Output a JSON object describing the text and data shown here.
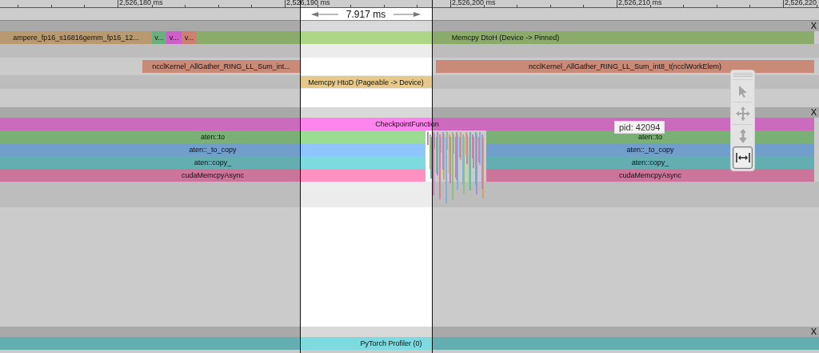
{
  "ruler": {
    "ticks": [
      "2,526,180 ms",
      "2,526,190 ms",
      "2,526,200 ms",
      "2,526,210 ms",
      "2,526,220"
    ]
  },
  "selection": {
    "duration": "7.917 ms"
  },
  "processes": [
    {
      "close": "X",
      "tracks": [
        {
          "slices": [
            {
              "label": "ampere_fp16_s16816gemm_fp16_12...",
              "color": "#b99a70"
            },
            {
              "label": "v...",
              "color": "#6ab07e"
            },
            {
              "label": "v...",
              "color": "#cc60c8"
            },
            {
              "label": "v...",
              "color": "#cc8070"
            },
            {
              "label": "Memcpy DtoH (Device -> Pinned)",
              "color": "#8aab6a"
            }
          ]
        },
        {
          "slices": [
            {
              "label": "ncclKernel_AllGather_RING_LL_Sum_int...",
              "color": "#c98a78"
            },
            {
              "label": "ncclKernel_AllGather_RING_LL_Sum_int8_t(ncclWorkElem)",
              "color": "#c98a78"
            }
          ]
        },
        {
          "slices": [
            {
              "label": "Memcpy HtoD (Pageable -> Device)",
              "color": "#e6c98a"
            }
          ]
        }
      ]
    },
    {
      "close": "X",
      "tracks": [
        {
          "slices": [
            {
              "label": "CheckpointFunction",
              "color": "#cc6abe"
            }
          ]
        },
        {
          "slices": [
            {
              "label": "aten::to",
              "color": "#7ab075"
            },
            {
              "label": "aten::to",
              "color": "#7ab075"
            }
          ]
        },
        {
          "slices": [
            {
              "label": "aten::_to_copy",
              "color": "#729ecc"
            },
            {
              "label": "aten::_to_copy",
              "color": "#729ecc"
            }
          ]
        },
        {
          "slices": [
            {
              "label": "aten::copy_",
              "color": "#64aeb2"
            },
            {
              "label": "aten::copy_",
              "color": "#64aeb2"
            }
          ]
        },
        {
          "slices": [
            {
              "label": "cudaMemcpyAsync",
              "color": "#cc749a"
            },
            {
              "label": "cudaMemcpyAsync",
              "color": "#cc749a"
            }
          ]
        }
      ]
    },
    {
      "close": "X",
      "tracks": [
        {
          "slices": [
            {
              "label": "PyTorch Profiler (0)",
              "color": "#64aeb2"
            }
          ]
        }
      ]
    }
  ],
  "tooltip": "pid: 42094",
  "toolbar": {
    "tools": [
      {
        "kind": "select",
        "selected": false
      },
      {
        "kind": "pan",
        "selected": false
      },
      {
        "kind": "zoom",
        "selected": false
      },
      {
        "kind": "timing",
        "selected": true
      }
    ]
  }
}
